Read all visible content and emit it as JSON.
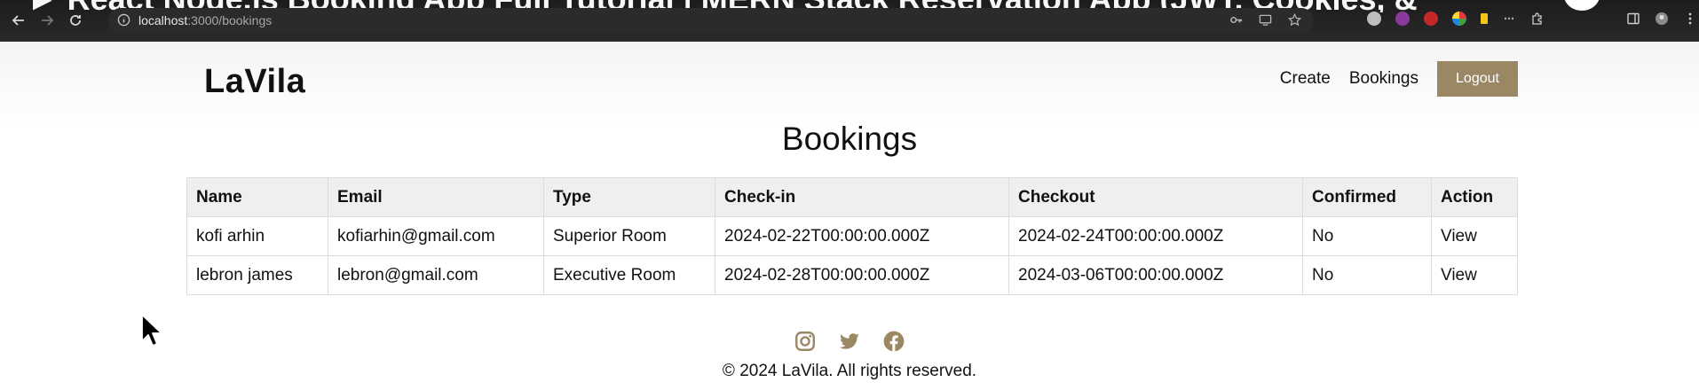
{
  "video_overlay": {
    "title": "► React Node.js Booking App Full Tutorial | MERN Stack Reservation App (JWT, Cookies, &"
  },
  "browser": {
    "url_host": "localhost",
    "url_path": ":3000/bookings"
  },
  "header": {
    "logo": "LaVila",
    "nav": {
      "create_label": "Create",
      "bookings_label": "Bookings",
      "logout_label": "Logout"
    }
  },
  "page": {
    "title": "Bookings"
  },
  "table": {
    "columns": [
      "Name",
      "Email",
      "Type",
      "Check-in",
      "Checkout",
      "Confirmed",
      "Action"
    ],
    "rows": [
      {
        "name": "kofi arhin",
        "email": "kofiarhin@gmail.com",
        "type": "Superior Room",
        "checkin": "2024-02-22T00:00:00.000Z",
        "checkout": "2024-02-24T00:00:00.000Z",
        "confirmed": "No",
        "action": "View"
      },
      {
        "name": "lebron james",
        "email": "lebron@gmail.com",
        "type": "Executive Room",
        "checkin": "2024-02-28T00:00:00.000Z",
        "checkout": "2024-03-06T00:00:00.000Z",
        "confirmed": "No",
        "action": "View"
      }
    ]
  },
  "footer": {
    "social_icons": [
      "instagram-icon",
      "twitter-icon",
      "facebook-icon"
    ],
    "copyright": "© 2024 LaVila. All rights reserved."
  },
  "colors": {
    "accent": "#9a8763",
    "table_header_bg": "#efefef",
    "chrome_bg": "#202020"
  }
}
